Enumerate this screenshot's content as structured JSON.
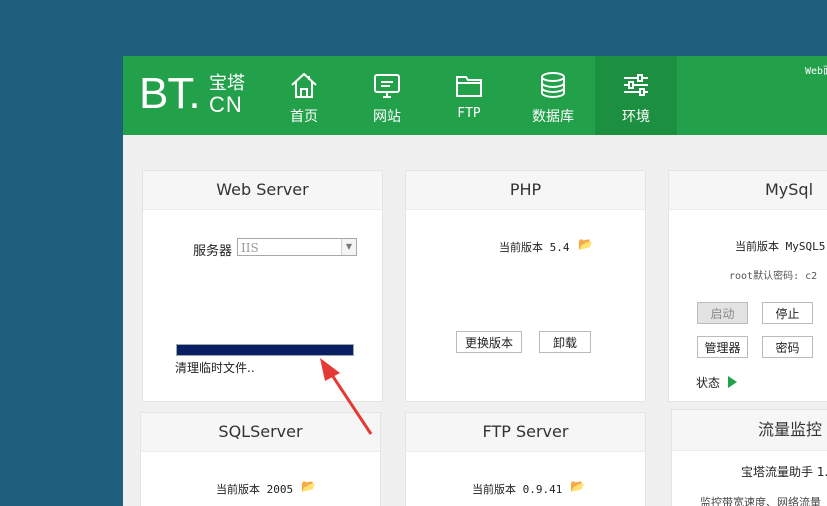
{
  "topbar": {
    "logo_bt": "BT.",
    "logo_cn_top": "宝塔",
    "logo_cn_bottom": "CN",
    "nav": [
      {
        "label": "首页",
        "icon": "home-icon"
      },
      {
        "label": "网站",
        "icon": "monitor-icon"
      },
      {
        "label": "FTP",
        "icon": "folder-icon"
      },
      {
        "label": "数据库",
        "icon": "database-icon"
      },
      {
        "label": "环境",
        "icon": "sliders-icon"
      }
    ],
    "right_text": "Web面"
  },
  "webserver": {
    "title": "Web Server",
    "server_label": "服务器",
    "server_value": "IIS",
    "progress_percent": 100,
    "status_text": "清理临时文件.."
  },
  "php": {
    "title": "PHP",
    "version_text": "当前版本 5.4",
    "switch_button": "更换版本",
    "uninstall_button": "卸载"
  },
  "mysql": {
    "title": "MySql",
    "version_text": "当前版本 MySQL5",
    "root_pwd_text": "root默认密码: c2",
    "start_button": "启动",
    "stop_button": "停止",
    "manage_button": "管理器",
    "password_button": "密码",
    "status_label": "状态"
  },
  "sqlserver": {
    "title": "SQLServer",
    "version_text": "当前版本 2005"
  },
  "ftpserver": {
    "title": "FTP Server",
    "version_text": "当前版本 0.9.41"
  },
  "traffic": {
    "title": "流量监控",
    "helper_text": "宝塔流量助手 1.",
    "desc_text": "监控带宽速度、网络流量"
  }
}
